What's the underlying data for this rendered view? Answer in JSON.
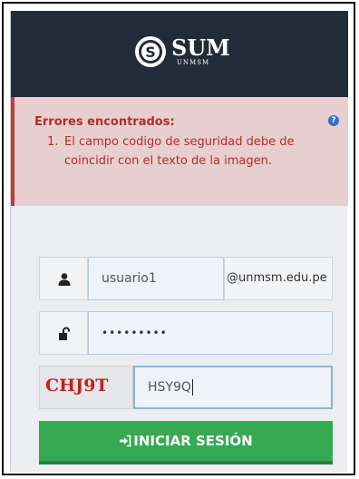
{
  "header": {
    "logo_text": "SUM",
    "logo_subtext": "UNMSM"
  },
  "alert": {
    "title": "Errores encontrados:",
    "items": [
      {
        "number": "1.",
        "text": "El campo codigo de seguridad debe de coincidir con el texto de la imagen."
      }
    ],
    "help_icon": "question-circle-icon"
  },
  "form": {
    "username": {
      "value": "usuario1",
      "domain_suffix": "@unmsm.edu.pe",
      "icon": "user-icon"
    },
    "password": {
      "masked_value": "•••••••••",
      "icon": "unlock-icon"
    },
    "captcha": {
      "image_text": "CHJ9T",
      "input_value": "HSY9Q"
    },
    "submit_label": "INICIAR SESIÓN",
    "submit_icon": "sign-in-icon"
  },
  "colors": {
    "header_bg": "#222c39",
    "alert_bg": "#e8cfcf",
    "alert_text": "#b22c2c",
    "button_green": "#35aa53",
    "captcha_red": "#c61f1f"
  }
}
